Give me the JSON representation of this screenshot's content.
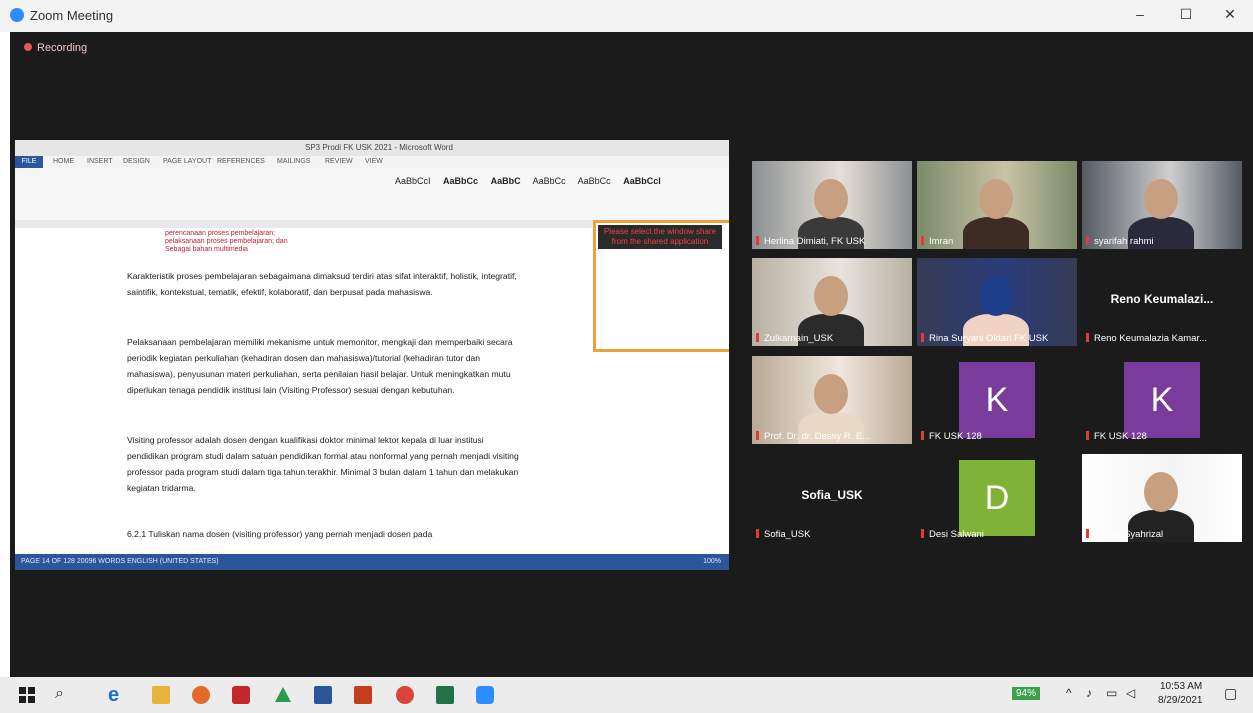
{
  "window": {
    "title": "Zoom Meeting",
    "minimize": "–",
    "maximize": "☐",
    "close": "✕"
  },
  "recording": {
    "label": "Recording"
  },
  "word": {
    "doc_title": "SP3 Prodi FK USK 2021 - Microsoft Word",
    "tabs": [
      "FILE",
      "HOME",
      "INSERT",
      "DESIGN",
      "PAGE LAYOUT",
      "REFERENCES",
      "MAILINGS",
      "REVIEW",
      "VIEW"
    ],
    "styles": [
      "AaBbCcI",
      "AaBbCc",
      "AaBbC",
      "AaBbCc",
      "AaBbCc",
      "AaBbCcI"
    ],
    "bullets": [
      "perencanaan proses pembelajaran;",
      "pelaksanaan proses pembelajaran; dan",
      "Sebagai bahan multimedia"
    ],
    "paragraphs": [
      "Karakteristik proses pembelajaran sebagaimana dimaksud terdiri atas sifat interaktif, holistik, integratif, saintifik, kontekstual, tematik, efektif, kolaboratif, dan berpusat pada mahasiswa.",
      "Pelaksanaan pembelajaran memiliki mekanisme untuk memonitor, mengkaji dan memperbaiki secara periodik kegiatan perkuliahan (kehadiran dosen dan mahasiswa)/tutorial (kehadiran tutor dan mahasiswa), penyusunan materi perkuliahan, serta penilaian hasil belajar. Untuk meningkatkan mutu diperlukan tenaga pendidik institusi lain (Visiting Professor) sesuai dengan kebutuhan.",
      "Visiting professor adalah dosen dengan kualifikasi doktor minimal lektor kepala di luar institusi pendidikan program studi dalam satuan pendidikan formal atau nonformal yang pernah menjadi visiting professor pada program studi dalam tiga tahun terakhir. Minimal 3 bulan dalam 1 tahun dan melakukan kegiatan tridarma.",
      "6.2.1  Tuliskan nama dosen (visiting professor) yang pernah menjadi dosen pada"
    ],
    "status_left": "PAGE 14 OF 128    20096 WORDS    ENGLISH (UNITED STATES)",
    "status_right": "100%",
    "notice": "Please select the window share from the shared application"
  },
  "participants": [
    {
      "name": "Herlina Dimiati, FK USK",
      "type": "video"
    },
    {
      "name": "Imran",
      "type": "video"
    },
    {
      "name": "syarifah rahmi",
      "type": "video"
    },
    {
      "name": "Zulkarnain_USK",
      "type": "video"
    },
    {
      "name": "Rina Suryani Oktari FK USK",
      "type": "video",
      "active": true
    },
    {
      "name": "Reno Keumalazia Kamar...",
      "type": "name",
      "display": "Reno Keumalazi..."
    },
    {
      "name": "Prof. Dr. dr. Dessy R. E...",
      "type": "video"
    },
    {
      "name": "FK USK 128",
      "type": "letter",
      "letter": "K",
      "color": "#7a3c9a"
    },
    {
      "name": "FK USK 128",
      "type": "letter",
      "letter": "K",
      "color": "#7a3c9a"
    },
    {
      "name": "Sofia_USK",
      "type": "name",
      "display": "Sofia_USK"
    },
    {
      "name": "Desi Salwani",
      "type": "letter",
      "letter": "D",
      "color": "#7fb236"
    },
    {
      "name": "Deddy Syahrizal",
      "type": "video"
    }
  ],
  "taskbar": {
    "battery": "94%",
    "time": "10:53 AM",
    "date": "8/29/2021",
    "apps": [
      "windows-icon",
      "search-icon",
      "edge-icon",
      "file-explorer-icon",
      "firefox-icon",
      "acrobat-icon",
      "drive-icon",
      "word-icon",
      "powerpoint-icon",
      "chrome-icon",
      "excel-icon",
      "zoom-icon"
    ]
  }
}
